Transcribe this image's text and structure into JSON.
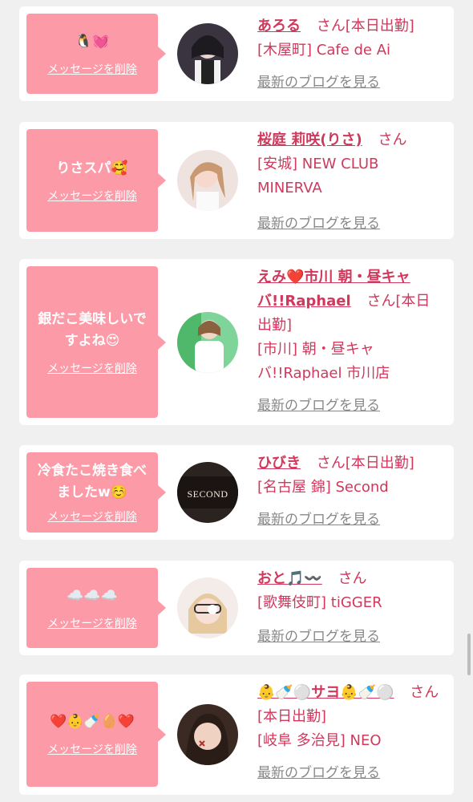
{
  "delete_label": "メッセージを削除",
  "blog_label": "最新のブログを見る",
  "cards": [
    {
      "message": "🐧💓",
      "name": "あろる",
      "san": "さん",
      "status": "[本日出勤]",
      "shop": "[木屋町] Cafe de Ai"
    },
    {
      "message": "りさスパ🥰",
      "name": "桜庭 莉咲(りさ)",
      "san": "さん",
      "status": "",
      "shop": "[安城] NEW CLUB MINERVA"
    },
    {
      "message": "銀だこ美味しいですよね😍",
      "name": "えみ❤️市川 朝・昼キャバ!!Raphael",
      "san": "さん",
      "status": "[本日出勤]",
      "shop": "[市川] 朝・昼キャバ!!Raphael 市川店"
    },
    {
      "message": "冷食たこ焼き食べましたw☺️",
      "name": "ひびき",
      "san": "さん",
      "status": "[本日出勤]",
      "shop": "[名古屋 錦] Second"
    },
    {
      "message": "☁️☁️☁️",
      "name": "おと🎵〰️",
      "san": "さん",
      "status": "",
      "shop": "[歌舞伎町] tiGGER"
    },
    {
      "message": "❤️👶🍼🥚❤️",
      "name": "👶🍼⚪️サヨ👶🍼⚪️",
      "san": "さん",
      "status": "[本日出勤]",
      "shop": "[岐阜 多治見] NEO"
    }
  ],
  "avatar_text": {
    "second": "SECOND"
  },
  "colors": {
    "accent": "#d0385c",
    "bubble": "#fd9aa8",
    "background": "#f0f0f0"
  }
}
